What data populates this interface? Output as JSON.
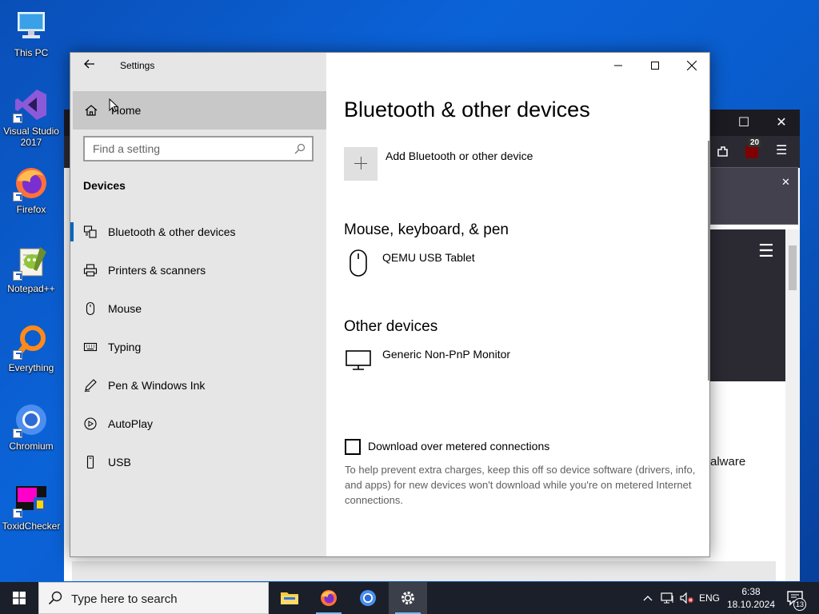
{
  "desktop": {
    "icons": [
      {
        "label": "This PC"
      },
      {
        "label": "Visual Studio 2017"
      },
      {
        "label": "Firefox"
      },
      {
        "label": "Notepad++"
      },
      {
        "label": "Everything"
      },
      {
        "label": "Chromium"
      },
      {
        "label": "ToxidChecker"
      }
    ]
  },
  "background_window": {
    "badge_count": "20",
    "partial_text": "alware"
  },
  "settings": {
    "app_title": "Settings",
    "home_label": "Home",
    "search": {
      "placeholder": "Find a setting"
    },
    "section": "Devices",
    "nav": [
      {
        "label": "Bluetooth & other devices",
        "icon": "bluetooth-devices-icon",
        "selected": true
      },
      {
        "label": "Printers & scanners",
        "icon": "printer-icon"
      },
      {
        "label": "Mouse",
        "icon": "mouse-icon"
      },
      {
        "label": "Typing",
        "icon": "keyboard-icon"
      },
      {
        "label": "Pen & Windows Ink",
        "icon": "pen-icon"
      },
      {
        "label": "AutoPlay",
        "icon": "autoplay-icon"
      },
      {
        "label": "USB",
        "icon": "usb-icon"
      }
    ],
    "page_title": "Bluetooth & other devices",
    "add_device_label": "Add Bluetooth or other device",
    "groups": [
      {
        "title": "Mouse, keyboard, & pen",
        "devices": [
          {
            "name": "QEMU USB Tablet",
            "icon": "mouse-icon"
          }
        ]
      },
      {
        "title": "Other devices",
        "devices": [
          {
            "name": "Generic Non-PnP Monitor",
            "icon": "monitor-icon"
          }
        ]
      }
    ],
    "metered": {
      "label": "Download over metered connections",
      "checked": false,
      "help": "To help prevent extra charges, keep this off so device software (drivers, info, and apps) for new devices won't download while you're on metered Internet connections."
    }
  },
  "taskbar": {
    "search_placeholder": "Type here to search",
    "language": "ENG",
    "time": "6:38",
    "date": "18.10.2024",
    "notification_count": "13"
  }
}
